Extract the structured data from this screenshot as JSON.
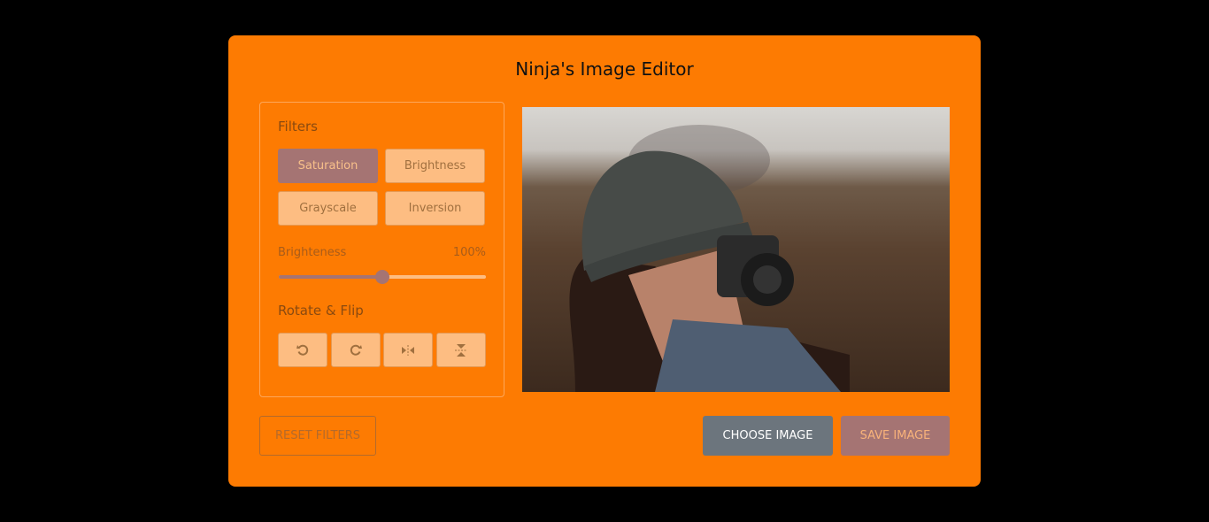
{
  "title": "Ninja's Image Editor",
  "filters": {
    "label": "Filters",
    "options": [
      "Saturation",
      "Brightness",
      "Grayscale",
      "Inversion"
    ],
    "active": "Saturation"
  },
  "slider": {
    "name": "Brighteness",
    "value_label": "100%",
    "fraction": 0.5
  },
  "rotate": {
    "label": "Rotate & Flip",
    "icons": [
      "rotate-left-icon",
      "rotate-right-icon",
      "flip-horizontal-icon",
      "flip-vertical-icon"
    ]
  },
  "buttons": {
    "reset": "RESET FILTERS",
    "choose": "CHOOSE IMAGE",
    "save": "SAVE IMAGE"
  },
  "colors": {
    "card": "#fd7b02",
    "active": "#a57473",
    "secondary": "#6c757d"
  }
}
